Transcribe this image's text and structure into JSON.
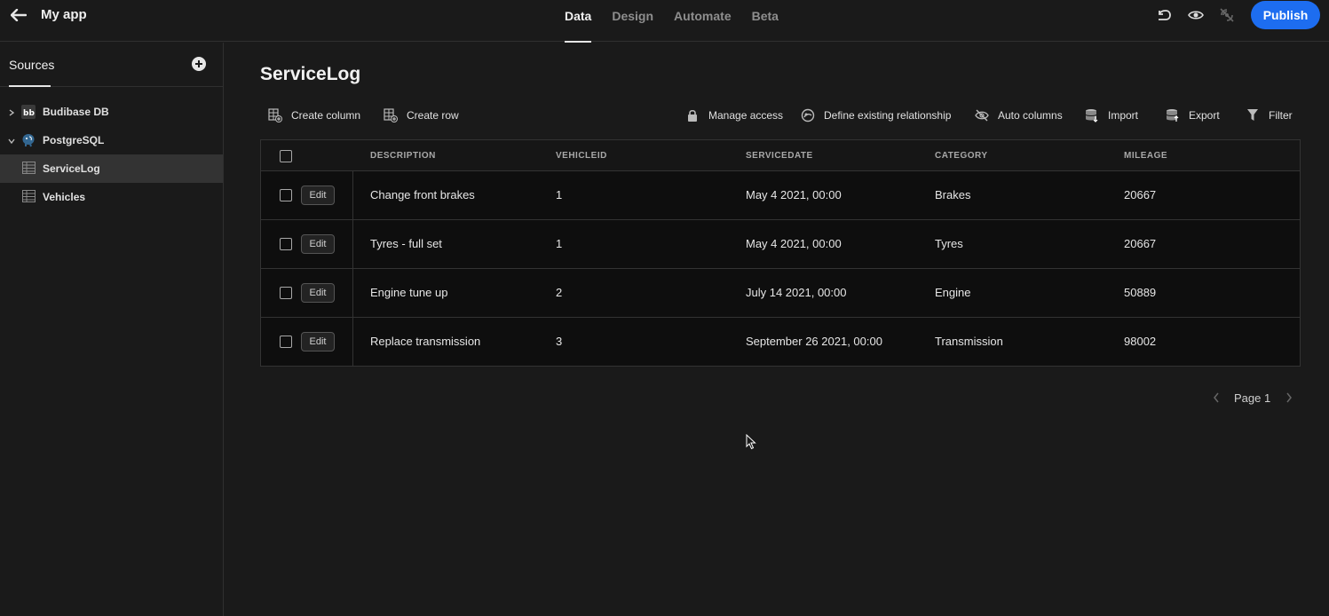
{
  "app": {
    "title": "My app"
  },
  "topnav": {
    "tabs": [
      {
        "label": "Data",
        "active": true
      },
      {
        "label": "Design",
        "active": false
      },
      {
        "label": "Automate",
        "active": false
      },
      {
        "label": "Beta",
        "active": false
      }
    ],
    "publish_label": "Publish",
    "icons": [
      "undo-icon",
      "eye-icon",
      "broadcast-off-icon"
    ]
  },
  "sidebar": {
    "header": "Sources",
    "items": [
      {
        "label": "Budibase DB",
        "icon": "budibase-icon",
        "expanded": false
      },
      {
        "label": "PostgreSQL",
        "icon": "postgresql-icon",
        "expanded": true
      },
      {
        "label": "ServiceLog",
        "icon": "table-icon",
        "selected": true
      },
      {
        "label": "Vehicles",
        "icon": "table-icon",
        "selected": false
      }
    ]
  },
  "main": {
    "title": "ServiceLog",
    "toolbar": {
      "create_column": "Create column",
      "create_row": "Create row",
      "manage_access": "Manage access",
      "define_relationship": "Define existing relationship",
      "auto_columns": "Auto columns",
      "import": "Import",
      "export": "Export",
      "filter": "Filter"
    },
    "table": {
      "edit_label": "Edit",
      "columns": [
        "DESCRIPTION",
        "VEHICLEID",
        "SERVICEDATE",
        "CATEGORY",
        "MILEAGE"
      ],
      "rows": [
        [
          "Change front brakes",
          "1",
          "May 4 2021, 00:00",
          "Brakes",
          "20667"
        ],
        [
          "Tyres - full set",
          "1",
          "May 4 2021, 00:00",
          "Tyres",
          "20667"
        ],
        [
          "Engine tune up",
          "2",
          "July 14 2021, 00:00",
          "Engine",
          "50889"
        ],
        [
          "Replace transmission",
          "3",
          "September 26 2021, 00:00",
          "Transmission",
          "98002"
        ]
      ]
    },
    "pagination": {
      "label": "Page 1"
    }
  },
  "colors": {
    "accent": "#1d6df0",
    "background": "#1a1a1a",
    "table_bg": "#0e0e0e"
  }
}
